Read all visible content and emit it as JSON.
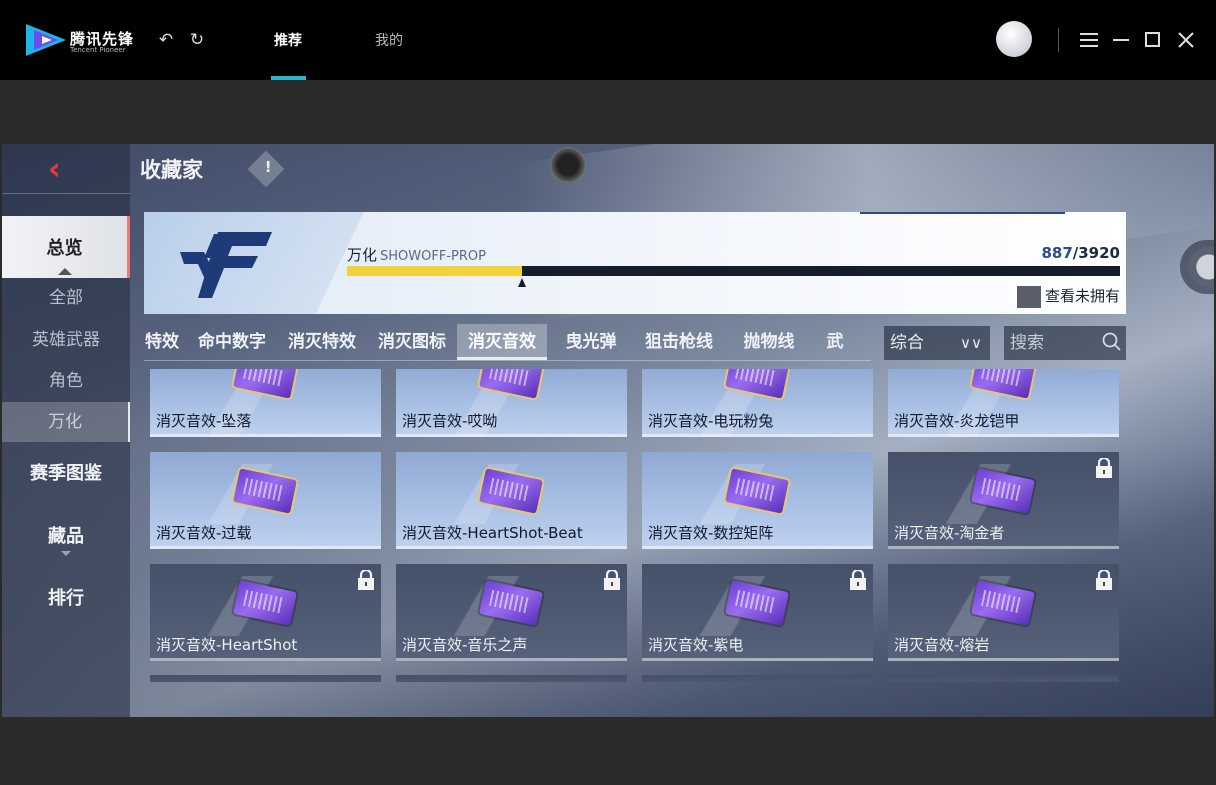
{
  "launcher": {
    "brand": "腾讯先锋",
    "brand_sub": "Tencent Pioneer",
    "tabs": [
      {
        "label": "推荐",
        "active": true
      },
      {
        "label": "我的",
        "active": false
      }
    ],
    "accent": "#26b7c8"
  },
  "game": {
    "page_title": "收藏家",
    "info_icon": "!",
    "sidebar": {
      "overview": "总览",
      "sub_items": [
        {
          "label": "全部",
          "active": false
        },
        {
          "label": "英雄武器",
          "active": false
        },
        {
          "label": "角色",
          "active": false
        },
        {
          "label": "万化",
          "active": true
        }
      ],
      "season": "赛季图鉴",
      "collection": "藏品",
      "ranking": "排行"
    },
    "banner": {
      "label_cn": "万化",
      "label_en": "SHOWOFF-PROP",
      "owned": "887",
      "total": "/3920",
      "progress": 0.2263,
      "show_unowned": "查看未拥有"
    },
    "tabs": [
      {
        "label": "特效",
        "active": false
      },
      {
        "label": "命中数字",
        "active": false
      },
      {
        "label": "消灭特效",
        "active": false
      },
      {
        "label": "消灭图标",
        "active": false
      },
      {
        "label": "消灭音效",
        "active": true
      },
      {
        "label": "曳光弹",
        "active": false
      },
      {
        "label": "狙击枪线",
        "active": false
      },
      {
        "label": "抛物线",
        "active": false
      },
      {
        "label": "武",
        "active": false
      }
    ],
    "sort": {
      "value": "综合"
    },
    "search": {
      "placeholder": "搜索"
    },
    "items": [
      {
        "name": "消灭音效-坠落",
        "owned": true
      },
      {
        "name": "消灭音效-哎呦",
        "owned": true
      },
      {
        "name": "消灭音效-电玩粉兔",
        "owned": true
      },
      {
        "name": "消灭音效-炎龙铠甲",
        "owned": true
      },
      {
        "name": "消灭音效-过载",
        "owned": true
      },
      {
        "name": "消灭音效-HeartShot-Beat",
        "owned": true
      },
      {
        "name": "消灭音效-数控矩阵",
        "owned": true
      },
      {
        "name": "消灭音效-淘金者",
        "owned": false
      },
      {
        "name": "消灭音效-HeartShot",
        "owned": false
      },
      {
        "name": "消灭音效-音乐之声",
        "owned": false
      },
      {
        "name": "消灭音效-紫电",
        "owned": false
      },
      {
        "name": "消灭音效-熔岩",
        "owned": false
      }
    ],
    "colors": {
      "progress": "#f2d23b",
      "back_chevron": "#e43b3b",
      "ticket": "#7a4de0"
    }
  }
}
